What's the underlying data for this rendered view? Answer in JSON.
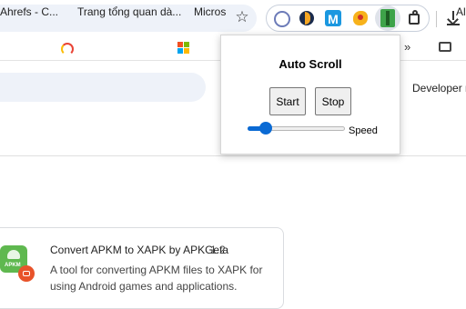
{
  "toolbar": {
    "extensions": [
      "extension-icon-1",
      "extension-icon-2",
      "m-extension-icon",
      "extension-icon-4",
      "auto-scroll-extension-icon"
    ],
    "m_icon_letter": "M"
  },
  "bookmarks": {
    "items": [
      {
        "label": "Ahrefs - C..."
      },
      {
        "label": "Trang tổng quan dà..."
      },
      {
        "label": "Micros"
      },
      {
        "label": "Al"
      }
    ],
    "more_label": "»"
  },
  "page": {
    "developer_mode_label": "Developer m",
    "extension_card": {
      "name": "Convert APKM to XAPK by APKGeta",
      "version": "1.2",
      "description": "A tool for converting APKM files to XAPK for using Android games and applications.",
      "icon_text": "APKM"
    }
  },
  "popup": {
    "title": "Auto Scroll",
    "start_label": "Start",
    "stop_label": "Stop",
    "speed_label": "Speed",
    "speed_fraction": 0.15
  }
}
